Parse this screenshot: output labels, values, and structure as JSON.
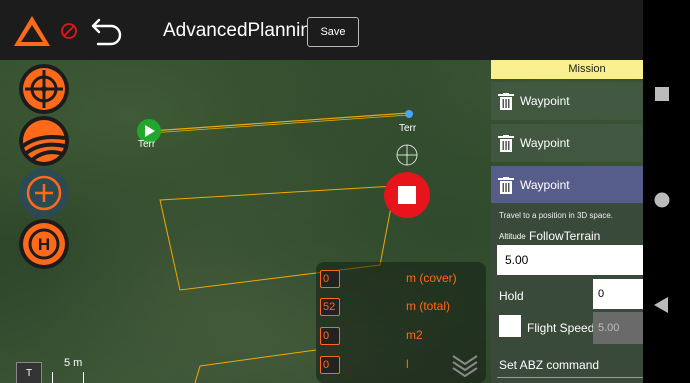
{
  "header": {
    "title": "AdvancedPlanning",
    "save_label": "Save"
  },
  "map": {
    "marker_labels": [
      "Terr",
      "Terr"
    ],
    "scale_toggle": "T",
    "scale_label": "5 m"
  },
  "stats": [
    {
      "value": "0",
      "unit": "m (cover)"
    },
    {
      "value": "52",
      "unit": "m (total)"
    },
    {
      "value": "0",
      "unit": "m2"
    },
    {
      "value": "0",
      "unit": "l"
    }
  ],
  "mission": {
    "header": "Mission",
    "waypoints": [
      "Waypoint",
      "Waypoint",
      "Waypoint"
    ],
    "description": "Travel to a position in 3D space.",
    "altitude_label": "Altitude",
    "altitude_mode": "FollowTerrain",
    "altitude_value": "5.00",
    "hold_label": "Hold",
    "hold_value": "0",
    "flight_speed_label": "Flight Speed",
    "flight_speed_value": "5.00",
    "abz_label": "Set ABZ command"
  },
  "colors": {
    "accent": "#ff6a1a",
    "stop": "#e8141c",
    "mission_header": "#f9ef8e",
    "active_waypoint": "#575d8a",
    "path": "#f2a900",
    "start": "#22a62c"
  }
}
